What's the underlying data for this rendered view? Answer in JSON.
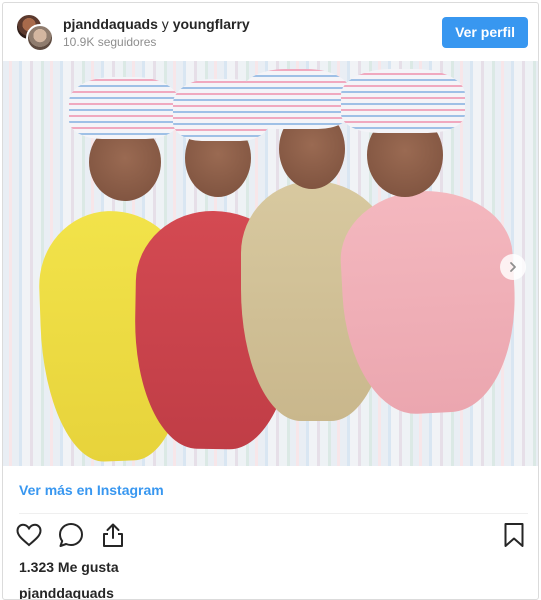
{
  "header": {
    "owner_1": "pjanddaquads",
    "joiner": "y",
    "owner_2": "youngflarry",
    "followers": "10.9K seguidores",
    "view_profile_label": "Ver perfil"
  },
  "post": {
    "photo_alt": "Quadruplets photo",
    "next_icon": "chevron-right-icon"
  },
  "footer": {
    "more_link": "Ver más en Instagram",
    "likes": "1.323 Me gusta",
    "caption_user": "pjanddaquads"
  },
  "icons": {
    "like": "heart-icon",
    "comment": "comment-icon",
    "share": "share-icon",
    "save": "bookmark-icon"
  },
  "colors": {
    "accent": "#3897f0",
    "text": "#262626",
    "muted": "#8e8e8e",
    "border": "#dbdbdb"
  }
}
